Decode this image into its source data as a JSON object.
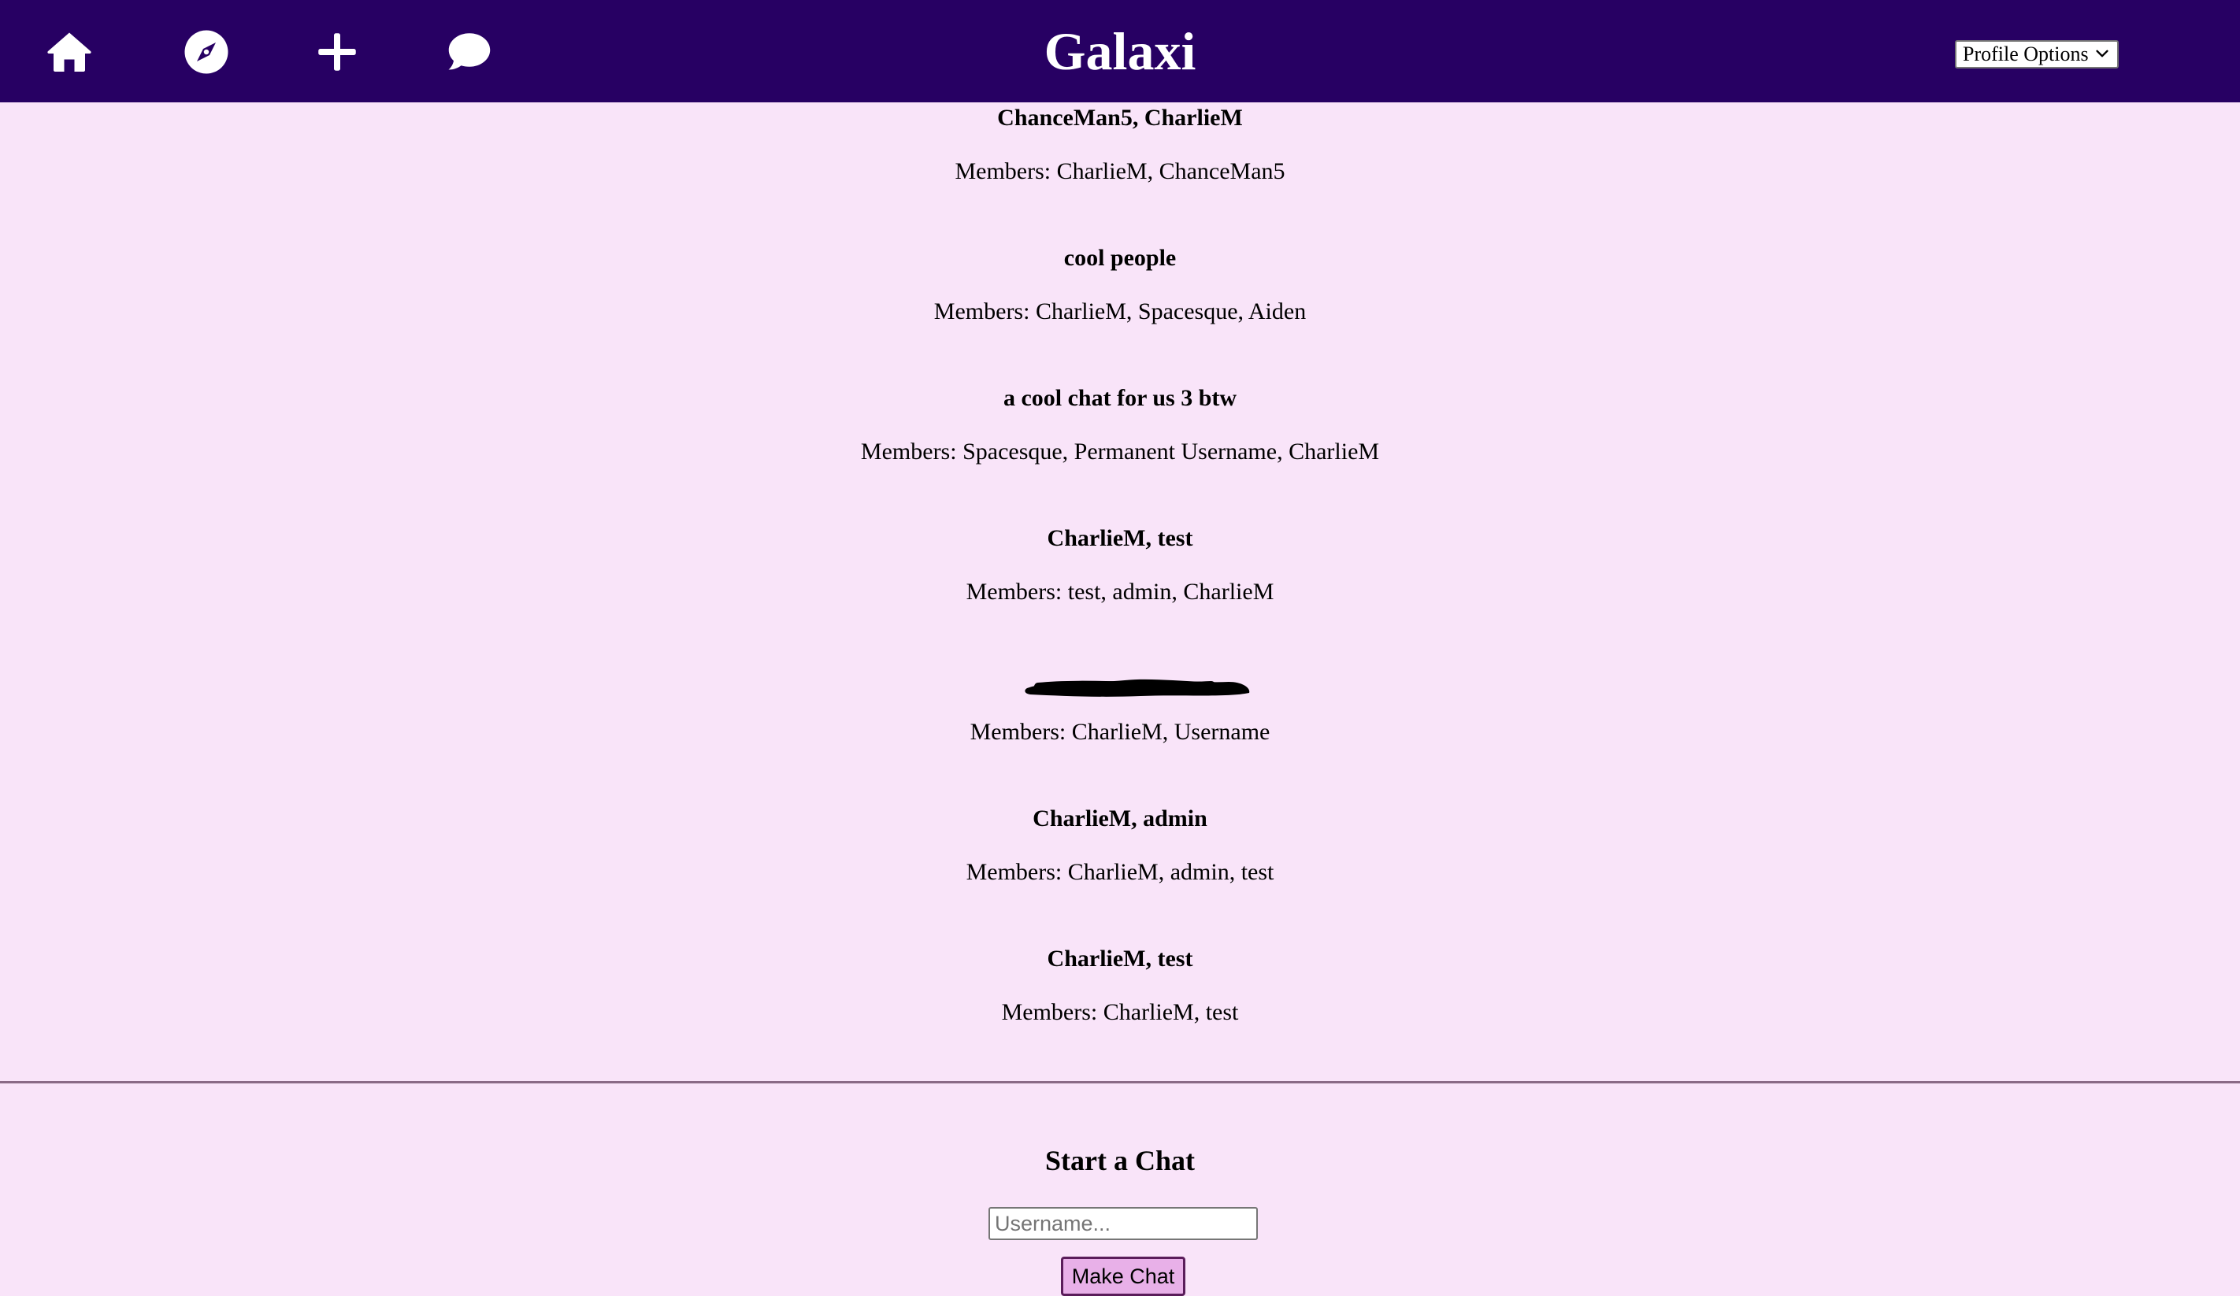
{
  "header": {
    "brand": "Galaxi",
    "nav_icons": [
      "home-icon",
      "compass-icon",
      "plus-icon",
      "chat-bubble-icon"
    ],
    "profile_select": {
      "selected": "Profile Options"
    },
    "background_color": "#270063"
  },
  "chats": [
    {
      "name": "ChanceMan5, CharlieM",
      "members": "Members: CharlieM, ChanceMan5"
    },
    {
      "name": "cool people",
      "members": "Members: CharlieM, Spacesque, Aiden"
    },
    {
      "name": "a cool chat for us 3 btw",
      "members": "Members: Spacesque, Permanent Username, CharlieM"
    },
    {
      "name": "CharlieM, test",
      "members": "Members: test, admin, CharlieM"
    },
    {
      "name": "",
      "members": "Members: CharlieM, Username",
      "name_redacted": true
    },
    {
      "name": "CharlieM, admin",
      "members": "Members: CharlieM, admin, test"
    },
    {
      "name": "CharlieM, test",
      "members": "Members: CharlieM, test"
    }
  ],
  "start_chat": {
    "title": "Start a Chat",
    "input_placeholder": "Username...",
    "input_value": "",
    "button_label": "Make Chat"
  },
  "colors": {
    "page_background": "#f9e4f9",
    "button_background": "#e8b0e8"
  }
}
